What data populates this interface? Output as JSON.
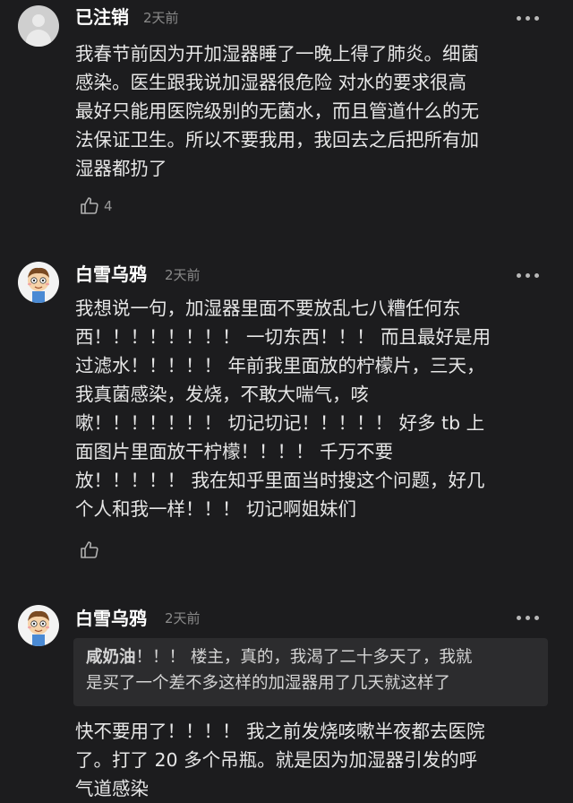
{
  "comments": [
    {
      "username": "已注销",
      "time": "2天前",
      "lines": [
        "我春节前因为开加湿器睡了一晚上得了肺炎。细菌",
        "感染。医生跟我说加湿器很危险 对水的要求很高",
        "最好只能用医院级别的无菌水，而且管道什么的无",
        "法保证卫生。所以不要我用，我回去之后把所有加",
        "湿器都扔了"
      ],
      "likes": "4"
    },
    {
      "username": "白雪乌鸦",
      "time": "2天前",
      "lines": [
        "我想说一句，加湿器里面不要放乱七八糟任何东",
        "西！！！！！！！！ 一切东西！！！ 而且最好是用",
        "过滤水！！！！！ 年前我里面放的柠檬片，三天，",
        "我真菌感染，发烧，不敢大喘气，咳",
        "嗽！！！！！！！ 切记切记！！！！！ 好多 tb 上",
        "面图片里面放干柠檬！！！！ 千万不要",
        "放！！！！！ 我在知乎里面当时搜这个问题，好几",
        "个人和我一样！！！ 切记啊姐妹们"
      ],
      "likes": ""
    },
    {
      "username": "白雪乌鸦",
      "time": "2天前",
      "quote": {
        "name": "咸奶油",
        "line1": "！！！ 楼主，真的，我渴了二十多天了，我就",
        "line2": "是买了一个差不多这样的加湿器用了几天就这样了"
      },
      "lines": [
        "快不要用了！！！！ 我之前发烧咳嗽半夜都去医院",
        "了。打了 20 多个吊瓶。就是因为加湿器引发的呼",
        "气道感染"
      ]
    }
  ],
  "icons": {
    "more": "more-dots-icon",
    "like": "thumbs-up-icon",
    "avatar_default": "default-avatar-icon",
    "avatar_cartoon": "cartoon-avatar-icon"
  },
  "colors": {
    "background": "#1c1c1e",
    "quote_background": "#2c2c2e",
    "username": "#ffffff",
    "time": "#8a8a8a",
    "body_text": "#e6e6e6"
  }
}
